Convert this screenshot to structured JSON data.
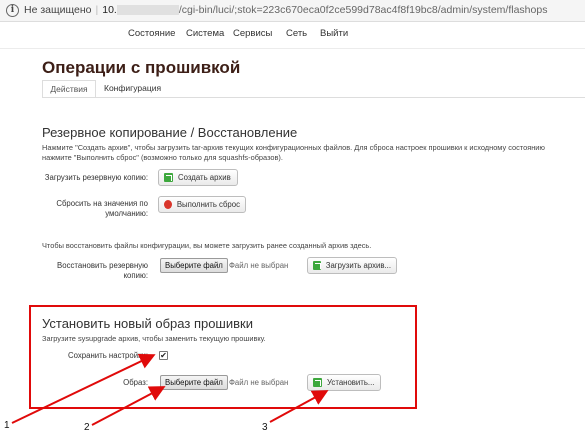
{
  "browser": {
    "security_label": "Не защищено",
    "host": "10.",
    "path": "/cgi-bin/luci/;stok=223c670eca0f2ce599d78ac4f8f19bc8/admin/system/flashops"
  },
  "nav": [
    "Состояние",
    "Система",
    "Сервисы",
    "Сеть",
    "Выйти"
  ],
  "page_title": "Операции с прошивкой",
  "tabs": {
    "actions": "Действия",
    "config": "Конфигурация"
  },
  "backup": {
    "title": "Резервное копирование / Восстановление",
    "desc_line1": "Нажмите \"Создать архив\", чтобы загрузить tar-архив текущих конфигурационных файлов. Для сброса настроек прошивки к исходному состоянию",
    "desc_line2": "нажмите \"Выполнить сброс\" (возможно только для squashfs-образов).",
    "download_label": "Загрузить резервную копию:",
    "create_button": "Создать архив",
    "reset_label_1": "Сбросить на значения по",
    "reset_label_2": "умолчанию:",
    "reset_button": "Выполнить сброс",
    "restore_desc": "Чтобы восстановить файлы конфигурации, вы можете загрузить ранее созданный архив здесь.",
    "restore_label_1": "Восстановить резервную",
    "restore_label_2": "копию:",
    "choose_file": "Выберите файл",
    "no_file": "Файл не выбран",
    "upload_button": "Загрузить архив..."
  },
  "flash": {
    "title": "Установить новый образ прошивки",
    "desc": "Загрузите sysupgrade архив, чтобы заменить текущую прошивку.",
    "keep_label": "Сохранить настройки:",
    "keep_checked": "✔",
    "image_label": "Образ:",
    "choose_file": "Выберите файл",
    "no_file": "Файл не выбран",
    "install_button": "Установить..."
  },
  "annotations": {
    "highlight_color": "#e00a0a",
    "markers": [
      "1",
      "2",
      "3"
    ]
  }
}
